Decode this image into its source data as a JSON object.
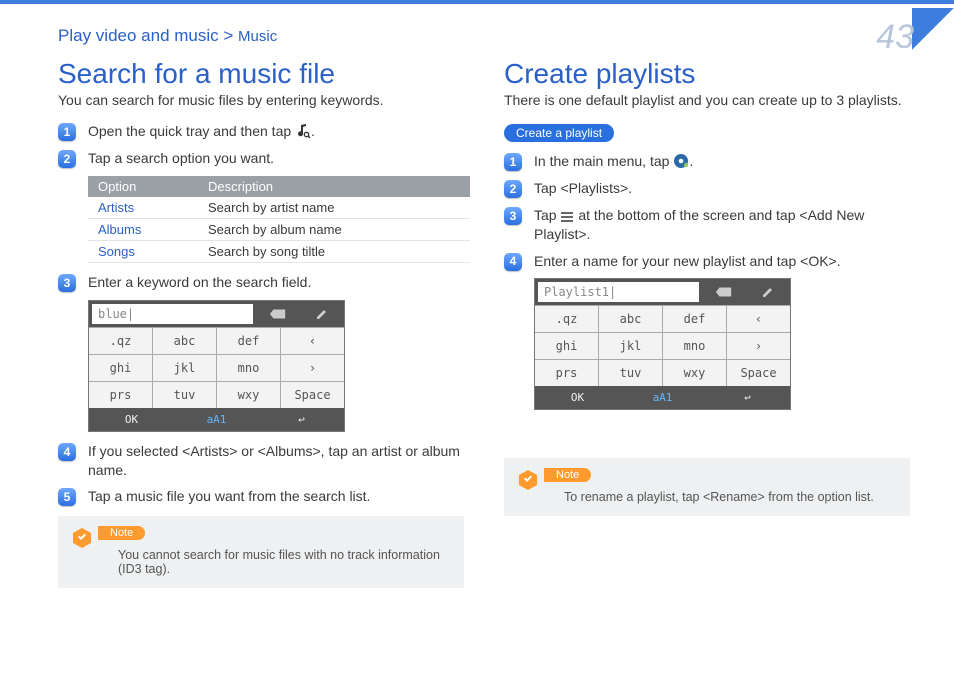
{
  "breadcrumb": {
    "main": "Play video and music",
    "sep": ">",
    "sub": "Music"
  },
  "page_number": "43",
  "left": {
    "heading": "Search for a music file",
    "lead": "You can search for music files by entering keywords.",
    "steps": {
      "s1a": "Open the quick tray and then tap ",
      "s1b": ".",
      "s2": "Tap a search option you want.",
      "s3": "Enter a keyword on the search field.",
      "s4": "If you selected <Artists> or <Albums>, tap an artist or album name.",
      "s5": "Tap a music file you want from the search list."
    },
    "table": {
      "h1": "Option",
      "h2": "Description",
      "r1o": "Artists",
      "r1d": "Search by artist name",
      "r2o": "Albums",
      "r2d": "Search by album name",
      "r3o": "Songs",
      "r3d": "Search by song tiltle"
    },
    "keypad": {
      "input": "blue|",
      "del": "DEL",
      "k": [
        ".qz",
        "abc",
        "def",
        "‹",
        "ghi",
        "jkl",
        "mno",
        "›",
        "prs",
        "tuv",
        "wxy",
        "Space"
      ],
      "ok": "OK",
      "mode": "aA1"
    },
    "note": {
      "label": "Note",
      "text": "You cannot search for music files with no track information (ID3 tag)."
    }
  },
  "right": {
    "heading": "Create playlists",
    "lead": "There is one default playlist and you can create up to 3 playlists.",
    "pill": "Create a playlist",
    "steps": {
      "s1a": "In the main menu, tap ",
      "s1b": ".",
      "s2": "Tap <Playlists>.",
      "s3a": "Tap ",
      "s3b": " at the bottom of the screen and tap <Add New Playlist>.",
      "s4": "Enter a name for your new playlist and tap <OK>."
    },
    "keypad": {
      "input": "Playlist1|",
      "del": "DEL",
      "k": [
        ".qz",
        "abc",
        "def",
        "‹",
        "ghi",
        "jkl",
        "mno",
        "›",
        "prs",
        "tuv",
        "wxy",
        "Space"
      ],
      "ok": "OK",
      "mode": "aA1"
    },
    "note": {
      "label": "Note",
      "text": "To rename a playlist, tap <Rename> from the option list."
    }
  }
}
